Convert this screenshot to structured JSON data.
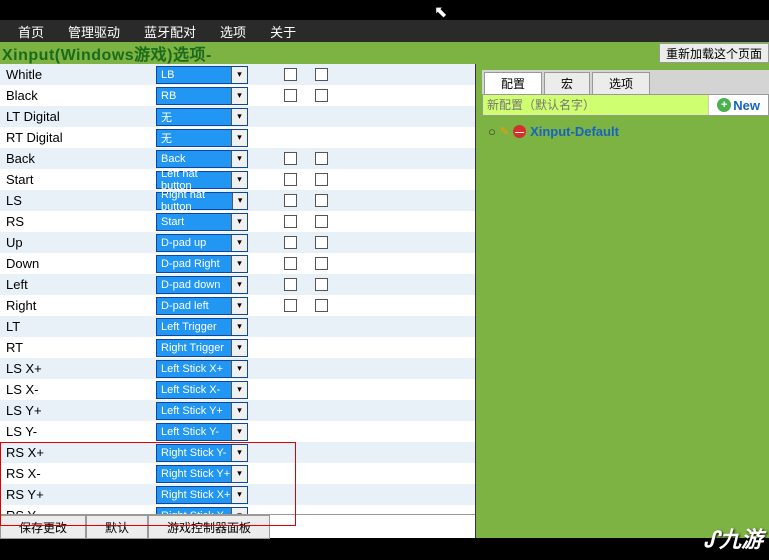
{
  "menu": [
    "首页",
    "管理驱动",
    "蓝牙配对",
    "选项",
    "关于"
  ],
  "title": "Xinput(Windows游戏)选项-",
  "reload": "重新加载这个页面",
  "rows": [
    {
      "label": "Whitle",
      "value": "LB",
      "cb": true
    },
    {
      "label": "Black",
      "value": "RB",
      "cb": true
    },
    {
      "label": "LT Digital",
      "value": "无",
      "cb": false
    },
    {
      "label": "RT Digital",
      "value": "无",
      "cb": false
    },
    {
      "label": "Back",
      "value": "Back",
      "cb": true
    },
    {
      "label": "Start",
      "value": "Left hat button",
      "cb": true
    },
    {
      "label": "LS",
      "value": "Right hat button",
      "cb": true
    },
    {
      "label": "RS",
      "value": "Start",
      "cb": true
    },
    {
      "label": "Up",
      "value": "D-pad up",
      "cb": true
    },
    {
      "label": "Down",
      "value": "D-pad Right",
      "cb": true
    },
    {
      "label": "Left",
      "value": "D-pad down",
      "cb": true
    },
    {
      "label": "Right",
      "value": "D-pad left",
      "cb": true
    },
    {
      "label": "LT",
      "value": "Left Trigger",
      "cb": false
    },
    {
      "label": "RT",
      "value": "Right Trigger",
      "cb": false
    },
    {
      "label": "LS X+",
      "value": "Left Stick X+",
      "cb": false
    },
    {
      "label": "LS X-",
      "value": "Left Stick X-",
      "cb": false
    },
    {
      "label": "LS Y+",
      "value": "Left Stick Y+",
      "cb": false
    },
    {
      "label": "LS Y-",
      "value": "Left Stick Y-",
      "cb": false
    },
    {
      "label": "RS X+",
      "value": "Right Stick Y-",
      "cb": false
    },
    {
      "label": "RS X-",
      "value": "Right Stick Y+",
      "cb": false
    },
    {
      "label": "RS Y+",
      "value": "Right Stick X+",
      "cb": false
    },
    {
      "label": "RS Y-",
      "value": "Right Stick X-",
      "cb": false
    }
  ],
  "footer": {
    "save": "保存更改",
    "default": "默认",
    "panel": "游戏控制器面板"
  },
  "tabs": {
    "config": "配置",
    "macro": "宏",
    "options": "选项"
  },
  "cfg_placeholder": "新配置（默认名字）",
  "new_label": "New",
  "cfg_item": "Xinput-Default",
  "logo": "九游"
}
